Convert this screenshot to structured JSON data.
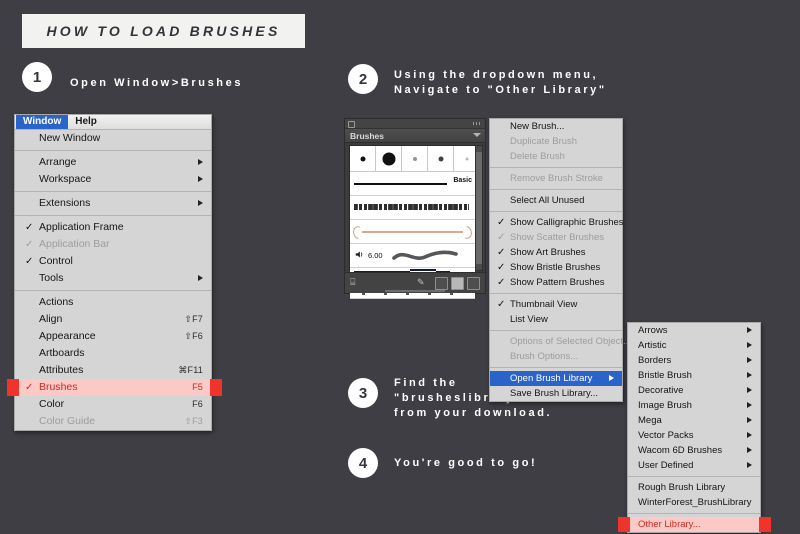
{
  "page": {
    "title": "HOW TO LOAD BRUSHES",
    "background_color": "#3e3e44",
    "banner_color": "#f2f2f0",
    "accent_red": "#f0342b",
    "accent_blue": "#2a64c8"
  },
  "steps": [
    {
      "number": "1",
      "text": "Open Window>Brushes"
    },
    {
      "number": "2",
      "text": "Using the dropdown menu,\nNavigate to \"Other Library\""
    },
    {
      "number": "3",
      "text": "Find the\n\"brusheslibrary.ai\"\nfrom your download."
    },
    {
      "number": "4",
      "text": "You're good to go!"
    }
  ],
  "window_menu": {
    "menubar": [
      {
        "label": "Window",
        "selected": true
      },
      {
        "label": "Help",
        "selected": false
      }
    ],
    "items": [
      {
        "label": "New Window",
        "check": "",
        "shortcut": "",
        "arrow": false,
        "dim": false,
        "highlight": ""
      },
      {
        "sep": true
      },
      {
        "label": "Arrange",
        "check": "",
        "shortcut": "",
        "arrow": true,
        "dim": false,
        "highlight": ""
      },
      {
        "label": "Workspace",
        "check": "",
        "shortcut": "",
        "arrow": true,
        "dim": false,
        "highlight": ""
      },
      {
        "sep": true
      },
      {
        "label": "Extensions",
        "check": "",
        "shortcut": "",
        "arrow": true,
        "dim": false,
        "highlight": ""
      },
      {
        "sep": true
      },
      {
        "label": "Application Frame",
        "check": "✓",
        "shortcut": "",
        "arrow": false,
        "dim": false,
        "highlight": ""
      },
      {
        "label": "Application Bar",
        "check": "✓",
        "shortcut": "",
        "arrow": false,
        "dim": true,
        "highlight": ""
      },
      {
        "label": "Control",
        "check": "✓",
        "shortcut": "",
        "arrow": false,
        "dim": false,
        "highlight": ""
      },
      {
        "label": "Tools",
        "check": "",
        "shortcut": "",
        "arrow": true,
        "dim": false,
        "highlight": ""
      },
      {
        "sep": true
      },
      {
        "label": "Actions",
        "check": "",
        "shortcut": "",
        "arrow": false,
        "dim": false,
        "highlight": ""
      },
      {
        "label": "Align",
        "check": "",
        "shortcut": "⇧F7",
        "arrow": false,
        "dim": false,
        "highlight": ""
      },
      {
        "label": "Appearance",
        "check": "",
        "shortcut": "⇧F6",
        "arrow": false,
        "dim": false,
        "highlight": ""
      },
      {
        "label": "Artboards",
        "check": "",
        "shortcut": "",
        "arrow": false,
        "dim": false,
        "highlight": ""
      },
      {
        "label": "Attributes",
        "check": "",
        "shortcut": "⌘F11",
        "arrow": false,
        "dim": false,
        "highlight": ""
      },
      {
        "label": "Brushes",
        "check": "✓",
        "shortcut": "F5",
        "arrow": false,
        "dim": false,
        "highlight": "red"
      },
      {
        "label": "Color",
        "check": "",
        "shortcut": "F6",
        "arrow": false,
        "dim": false,
        "highlight": ""
      },
      {
        "label": "Color Guide",
        "check": "",
        "shortcut": "⇧F3",
        "arrow": false,
        "dim": true,
        "highlight": ""
      }
    ]
  },
  "brushes_panel": {
    "tab_label": "Brushes",
    "basic_label": "Basic",
    "size_value": "6.00"
  },
  "brush_menu": {
    "items": [
      {
        "label": "New Brush...",
        "check": "",
        "arrow": false,
        "dim": false,
        "highlight": ""
      },
      {
        "label": "Duplicate Brush",
        "check": "",
        "arrow": false,
        "dim": true,
        "highlight": ""
      },
      {
        "label": "Delete Brush",
        "check": "",
        "arrow": false,
        "dim": true,
        "highlight": ""
      },
      {
        "sep": true
      },
      {
        "label": "Remove Brush Stroke",
        "check": "",
        "arrow": false,
        "dim": true,
        "highlight": ""
      },
      {
        "sep": true
      },
      {
        "label": "Select All Unused",
        "check": "",
        "arrow": false,
        "dim": false,
        "highlight": ""
      },
      {
        "sep": true
      },
      {
        "label": "Show Calligraphic Brushes",
        "check": "✓",
        "arrow": false,
        "dim": false,
        "highlight": ""
      },
      {
        "label": "Show Scatter Brushes",
        "check": "✓",
        "arrow": false,
        "dim": true,
        "highlight": ""
      },
      {
        "label": "Show Art Brushes",
        "check": "✓",
        "arrow": false,
        "dim": false,
        "highlight": ""
      },
      {
        "label": "Show Bristle Brushes",
        "check": "✓",
        "arrow": false,
        "dim": false,
        "highlight": ""
      },
      {
        "label": "Show Pattern Brushes",
        "check": "✓",
        "arrow": false,
        "dim": false,
        "highlight": ""
      },
      {
        "sep": true
      },
      {
        "label": "Thumbnail View",
        "check": "✓",
        "arrow": false,
        "dim": false,
        "highlight": ""
      },
      {
        "label": "List View",
        "check": "",
        "arrow": false,
        "dim": false,
        "highlight": ""
      },
      {
        "sep": true
      },
      {
        "label": "Options of Selected Object...",
        "check": "",
        "arrow": false,
        "dim": true,
        "highlight": ""
      },
      {
        "label": "Brush Options...",
        "check": "",
        "arrow": false,
        "dim": true,
        "highlight": ""
      },
      {
        "sep": true
      },
      {
        "label": "Open Brush Library",
        "check": "",
        "arrow": true,
        "dim": false,
        "highlight": "blue"
      },
      {
        "label": "Save Brush Library...",
        "check": "",
        "arrow": false,
        "dim": false,
        "highlight": ""
      }
    ]
  },
  "library_menu": {
    "items": [
      {
        "label": "Arrows",
        "arrow": true,
        "highlight": ""
      },
      {
        "label": "Artistic",
        "arrow": true,
        "highlight": ""
      },
      {
        "label": "Borders",
        "arrow": true,
        "highlight": ""
      },
      {
        "label": "Bristle Brush",
        "arrow": true,
        "highlight": ""
      },
      {
        "label": "Decorative",
        "arrow": true,
        "highlight": ""
      },
      {
        "label": "Image Brush",
        "arrow": true,
        "highlight": ""
      },
      {
        "label": "Mega",
        "arrow": true,
        "highlight": ""
      },
      {
        "label": "Vector Packs",
        "arrow": true,
        "highlight": ""
      },
      {
        "label": "Wacom 6D Brushes",
        "arrow": true,
        "highlight": ""
      },
      {
        "label": "User Defined",
        "arrow": true,
        "highlight": ""
      },
      {
        "sep": true
      },
      {
        "label": "Rough Brush Library",
        "arrow": false,
        "highlight": ""
      },
      {
        "label": "WinterForest_BrushLibrary",
        "arrow": false,
        "highlight": ""
      },
      {
        "sep": true
      },
      {
        "label": "Other Library...",
        "arrow": false,
        "highlight": "red"
      }
    ]
  }
}
